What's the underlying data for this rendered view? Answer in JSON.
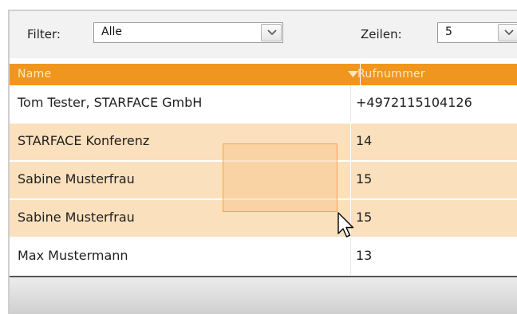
{
  "toolbar": {
    "filter_label": "Filter:",
    "filter_value": "Alle",
    "rows_label": "Zeilen:",
    "rows_value": "5"
  },
  "table": {
    "columns": [
      "Name",
      "Rufnummer"
    ],
    "rows": [
      {
        "name": "Tom Tester, STARFACE GmbH",
        "number": "+4972115104126",
        "selected": false
      },
      {
        "name": "STARFACE Konferenz",
        "number": "14",
        "selected": true
      },
      {
        "name": "Sabine Musterfrau",
        "number": "15",
        "selected": true
      },
      {
        "name": "Sabine Musterfrau",
        "number": "15",
        "selected": true
      },
      {
        "name": "Max Mustermann",
        "number": "13",
        "selected": false
      }
    ]
  },
  "icons": {
    "dropdown": "chevron-down-icon",
    "sort": "sort-desc-triangle-icon",
    "pointer": "mouse-cursor-icon"
  },
  "colors": {
    "header_bg": "#f0961e",
    "header_text": "#fde7c6",
    "selected_row_bg": "#fbe0bd",
    "lasso_fill": "#f8c486",
    "lasso_border": "#f4a63a"
  }
}
